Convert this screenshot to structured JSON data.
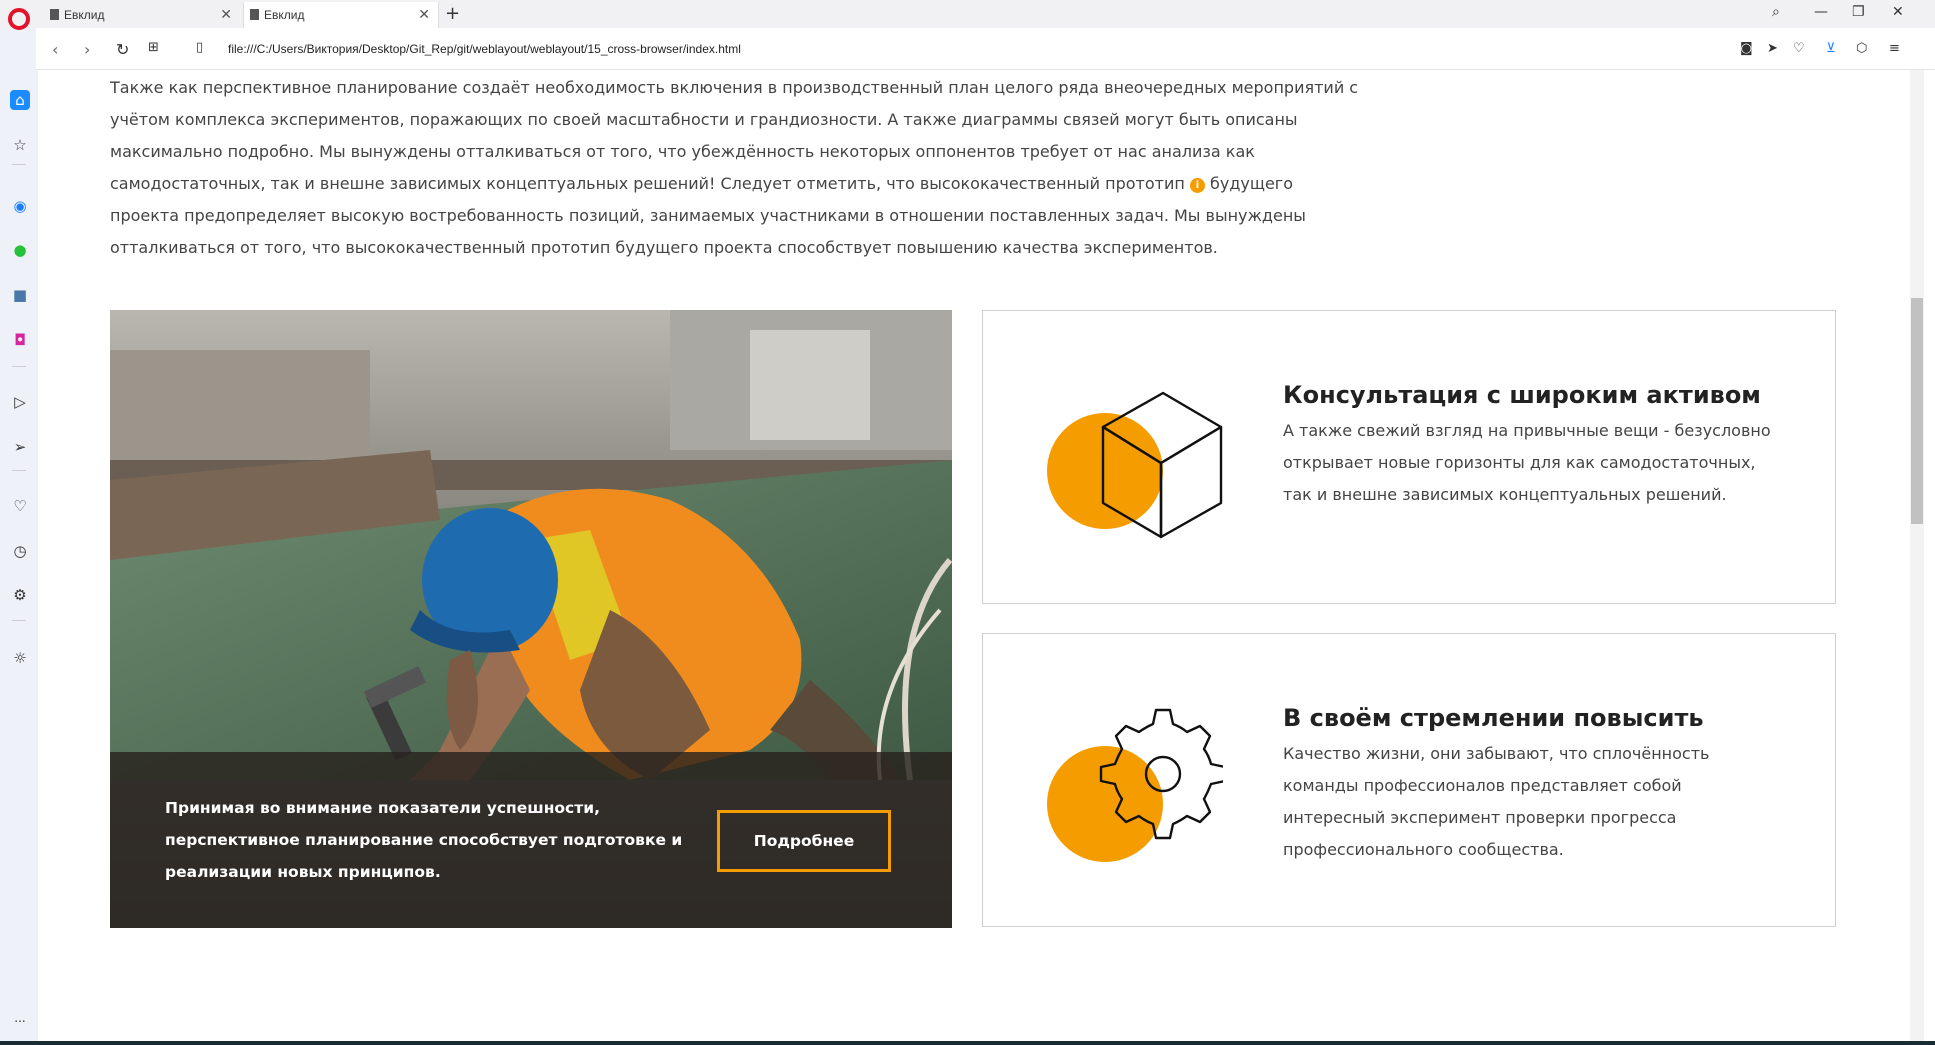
{
  "browser": {
    "tabs": [
      {
        "label": "Евклид"
      },
      {
        "label": "Евклид"
      }
    ],
    "new_tab": "+",
    "url": "file:///C:/Users/Виктория/Desktop/Git_Rep/git/weblayout/weblayout/15_cross-browser/index.html",
    "sidebar_more": "..."
  },
  "intro": {
    "text_before_icon": "Также как перспективное планирование создаёт необходимость включения в производственный план целого ряда внеочередных мероприятий с учётом комплекса экспериментов, поражающих по своей масштабности и грандиозности. А также диаграммы связей могут быть описаны максимально подробно. Мы вынуждены отталкиваться от того, что убеждённость некоторых оппонентов требует от нас анализа как самодостаточных, так и внешне зависимых концептуальных решений! Следует отметить, что высококачественный прототип",
    "info_icon": "i",
    "text_after_icon": "будущего проекта предопределяет высокую востребованность позиций, занимаемых участниками в отношении поставленных задач. Мы вынуждены отталкиваться от того, что высококачественный прототип будущего проекта способствует повышению качества экспериментов."
  },
  "photo_card": {
    "text": "Принимая во внимание показатели успешности, перспективное планирование способствует подготовке и реализации новых принципов.",
    "button": "Подробнее"
  },
  "features": [
    {
      "icon": "cube-icon",
      "title": "Консультация с широким активом",
      "description": "А также свежий взгляд на привычные вещи - безусловно открывает новые горизонты для как самодостаточных, так и внешне зависимых концептуальных решений."
    },
    {
      "icon": "gear-icon",
      "title": "В своём стремлении повысить",
      "description": "Качество жизни, они забывают, что сплочённость команды профессионалов представляет собой интересный эксперимент проверки прогресса профессионального сообщества."
    }
  ],
  "colors": {
    "accent": "#f59c00",
    "text": "#444444",
    "overlay": "#28221e"
  }
}
